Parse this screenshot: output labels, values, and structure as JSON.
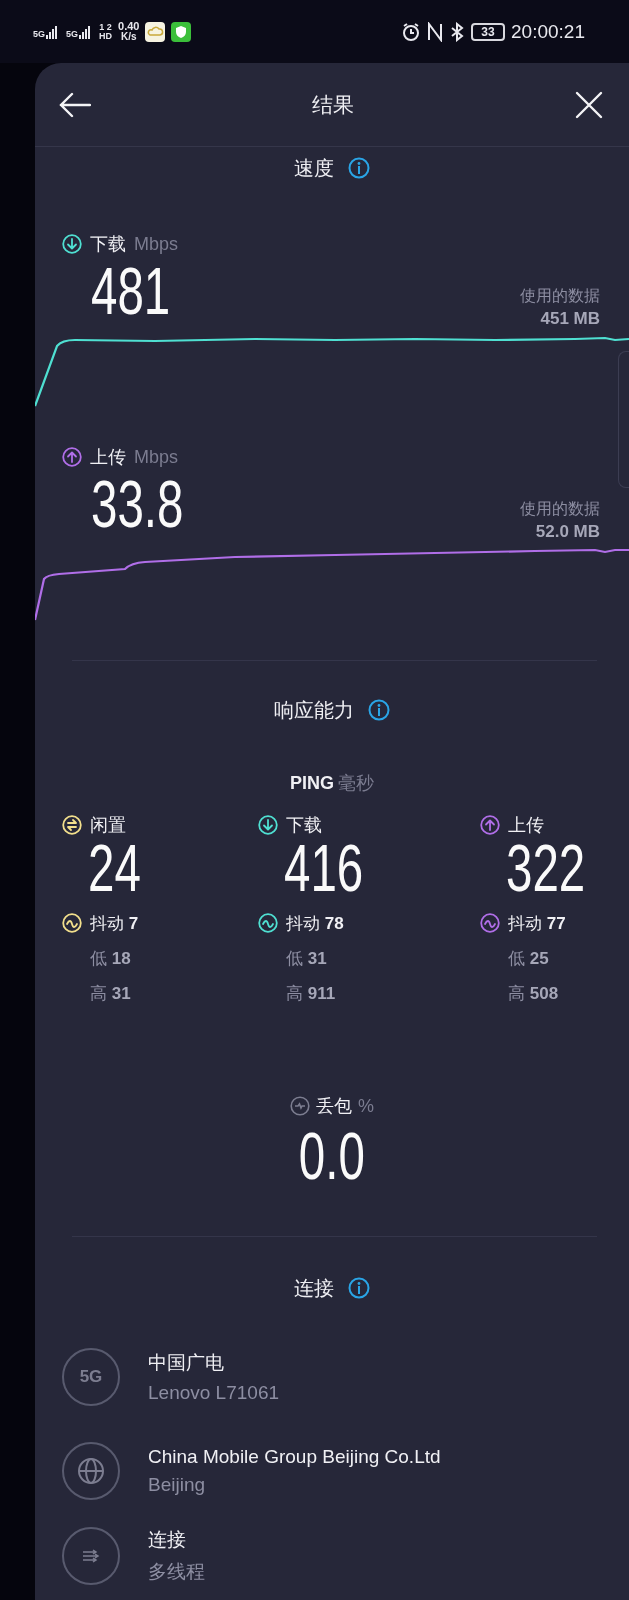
{
  "status_bar": {
    "sim_1": "5G",
    "sim_2": "5G",
    "hd_top": "1 2",
    "hd_bottom": "HD",
    "net_speed_value": "0.40",
    "net_speed_unit": "K/s",
    "battery": "33",
    "time": "20:00:21"
  },
  "header": {
    "title": "结果"
  },
  "speed": {
    "title": "速度",
    "metrics": [
      {
        "kind": "download",
        "label": "下载",
        "unit": "Mbps",
        "value": "481",
        "data_label": "使用的数据",
        "data_value": "451 MB",
        "color": "#4fe0d2"
      },
      {
        "kind": "upload",
        "label": "上传",
        "unit": "Mbps",
        "value": "33.8",
        "data_label": "使用的数据",
        "data_value": "52.0 MB",
        "color": "#b06ee8"
      }
    ]
  },
  "responsiveness": {
    "title": "响应能力",
    "ping_label": "PING",
    "ping_unit": "毫秒",
    "columns": [
      {
        "kind": "idle",
        "label": "闲置",
        "value": "24",
        "jitter_label": "抖动",
        "jitter": "7",
        "low_label": "低",
        "low": "18",
        "high_label": "高",
        "high": "31",
        "color": "#f2df8c"
      },
      {
        "kind": "download",
        "label": "下载",
        "value": "416",
        "jitter_label": "抖动",
        "jitter": "78",
        "low_label": "低",
        "low": "31",
        "high_label": "高",
        "high": "911",
        "color": "#4fe0d2"
      },
      {
        "kind": "upload",
        "label": "上传",
        "value": "322",
        "jitter_label": "抖动",
        "jitter": "77",
        "low_label": "低",
        "low": "25",
        "high_label": "高",
        "high": "508",
        "color": "#b06ee8"
      }
    ]
  },
  "packet_loss": {
    "label": "丢包",
    "unit": "%",
    "value": "0.0"
  },
  "connection": {
    "title": "连接",
    "items": [
      {
        "kind": "network",
        "icon_text": "5G",
        "title": "中国广电",
        "subtitle": "Lenovo L71061"
      },
      {
        "kind": "provider",
        "title": "China Mobile Group Beijing Co.Ltd",
        "subtitle": "Beijing"
      },
      {
        "kind": "mode",
        "title": "连接",
        "subtitle": "多线程"
      }
    ]
  }
}
